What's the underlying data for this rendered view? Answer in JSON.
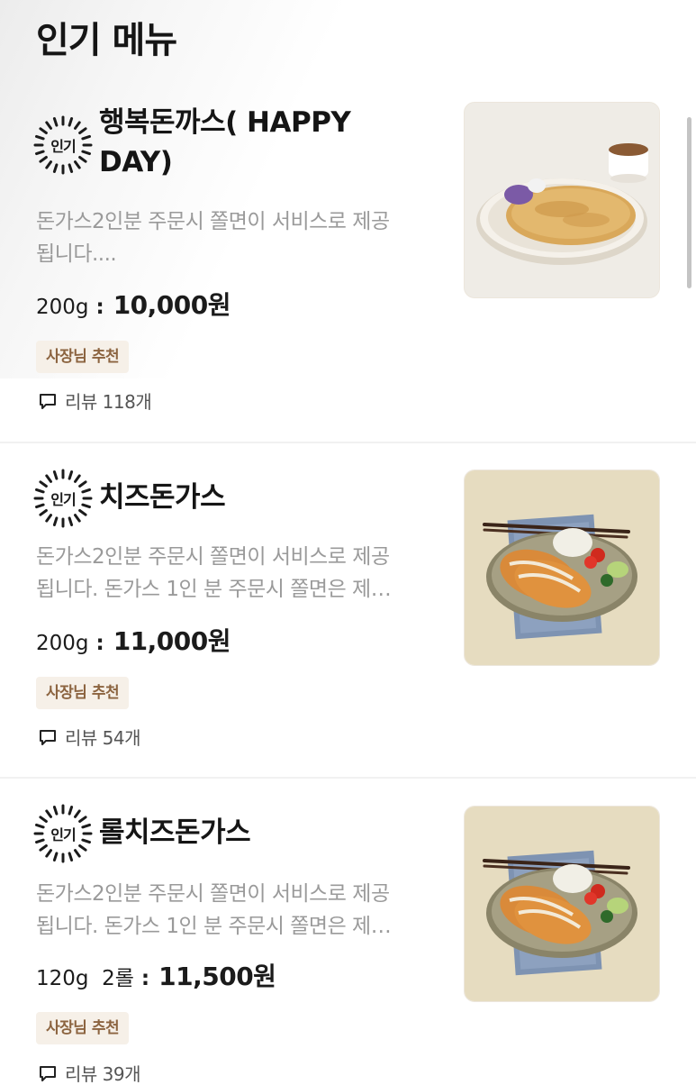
{
  "section_title": "인기 메뉴",
  "badge_label": "인기",
  "tag_label": "사장님 추천",
  "review_prefix": "리뷰",
  "items": [
    {
      "name": "행복돈까스( HAPPY DAY)",
      "name_lines": [
        "행복돈까스( HAPPY",
        "DAY)"
      ],
      "description_lines": [
        "돈가스2인분 주문시 쫄면이 서비스로 제공",
        "됩니다...."
      ],
      "weight": "200g",
      "price": "10,000원",
      "review_count": "118개",
      "image": "tonkatsu-plate-photo"
    },
    {
      "name": "치즈돈가스",
      "name_lines": [
        "치즈돈가스"
      ],
      "description_lines": [
        "돈가스2인분 주문시 쫄면이 서비스로 제공",
        "됩니다. 돈가스 1인 분 주문시 쫄면은 제…"
      ],
      "weight": "200g",
      "price": "11,000원",
      "review_count": "54개",
      "image": "cheese-tonkatsu-photo"
    },
    {
      "name": "롤치즈돈가스",
      "name_lines": [
        "롤치즈돈가스"
      ],
      "description_lines": [
        "돈가스2인분 주문시 쫄면이 서비스로 제공",
        "됩니다. 돈가스 1인 분 주문시 쫄면은 제…"
      ],
      "weight": "120g  2롤",
      "price": "11,500원",
      "review_count": "39개",
      "image": "roll-cheese-tonkatsu-photo"
    }
  ],
  "colors": {
    "tag_bg": "#f6f0e8",
    "tag_text": "#8c6440",
    "description": "#9a9a9a",
    "divider": "#f1f1f1"
  }
}
